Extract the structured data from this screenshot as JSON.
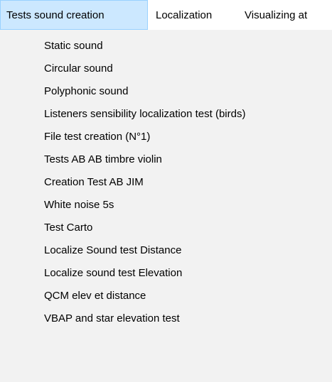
{
  "menubar": {
    "items": [
      {
        "label": "Tests sound creation"
      },
      {
        "label": "Localization"
      },
      {
        "label": "Visualizing at"
      }
    ]
  },
  "dropdown": {
    "items": [
      {
        "label": "Static sound"
      },
      {
        "label": "Circular sound"
      },
      {
        "label": "Polyphonic sound"
      },
      {
        "label": "Listeners sensibility localization test (birds)"
      },
      {
        "label": "File test creation (N°1)"
      },
      {
        "label": "Tests AB AB timbre violin"
      },
      {
        "label": "Creation Test AB JIM"
      },
      {
        "label": "White noise 5s"
      },
      {
        "label": "Test Carto"
      },
      {
        "label": "Localize Sound test Distance"
      },
      {
        "label": "Localize sound test Elevation"
      },
      {
        "label": "QCM elev et distance"
      },
      {
        "label": "VBAP and star elevation test"
      }
    ]
  }
}
